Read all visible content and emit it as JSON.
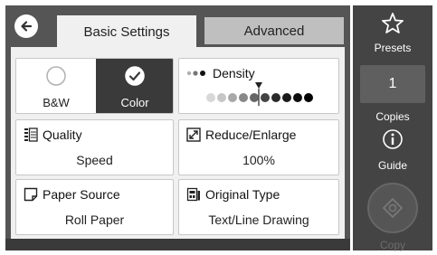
{
  "tabs": {
    "basic_label": "Basic Settings",
    "advanced_label": "Advanced"
  },
  "color_mode": {
    "bw_label": "B&W",
    "color_label": "Color",
    "selected": "Color"
  },
  "density": {
    "label": "Density"
  },
  "quality": {
    "label": "Quality",
    "value": "Speed"
  },
  "reduce_enlarge": {
    "label": "Reduce/Enlarge",
    "value": "100%"
  },
  "paper_source": {
    "label": "Paper Source",
    "value": "Roll Paper"
  },
  "original_type": {
    "label": "Original Type",
    "value": "Text/Line Drawing"
  },
  "sidebar": {
    "presets_label": "Presets",
    "copies_value": "1",
    "copies_label": "Copies",
    "guide_label": "Guide",
    "copy_label": "Copy"
  },
  "colors": {
    "accent_dark": "#3a3a3a",
    "tab_active": "#f0f0f0",
    "tab_inactive": "#bfbfbf"
  }
}
